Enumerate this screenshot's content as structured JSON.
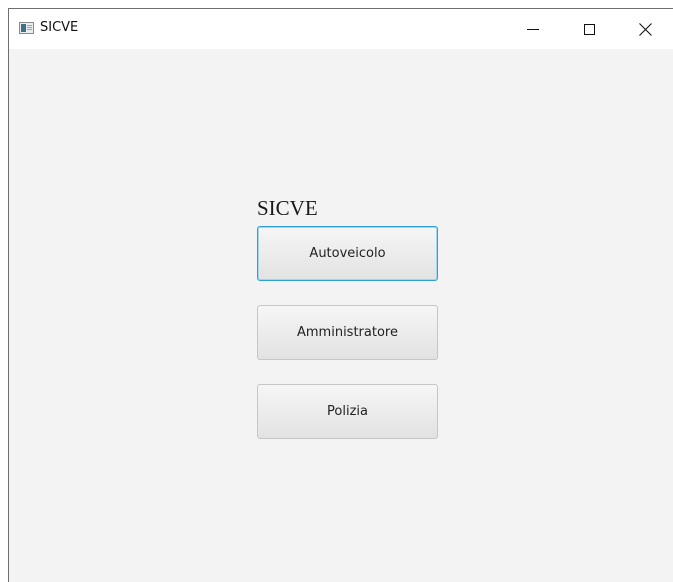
{
  "window": {
    "title": "SICVE",
    "controls": {
      "minimize": "minimize-icon",
      "maximize": "maximize-icon",
      "close": "close-icon"
    }
  },
  "main": {
    "heading": "SICVE",
    "buttons": [
      {
        "label": "Autoveicolo",
        "focused": true
      },
      {
        "label": "Amministratore",
        "focused": false
      },
      {
        "label": "Polizia",
        "focused": false
      }
    ]
  },
  "colors": {
    "focus_border": "#2e9fd7",
    "background": "#f3f3f3"
  }
}
